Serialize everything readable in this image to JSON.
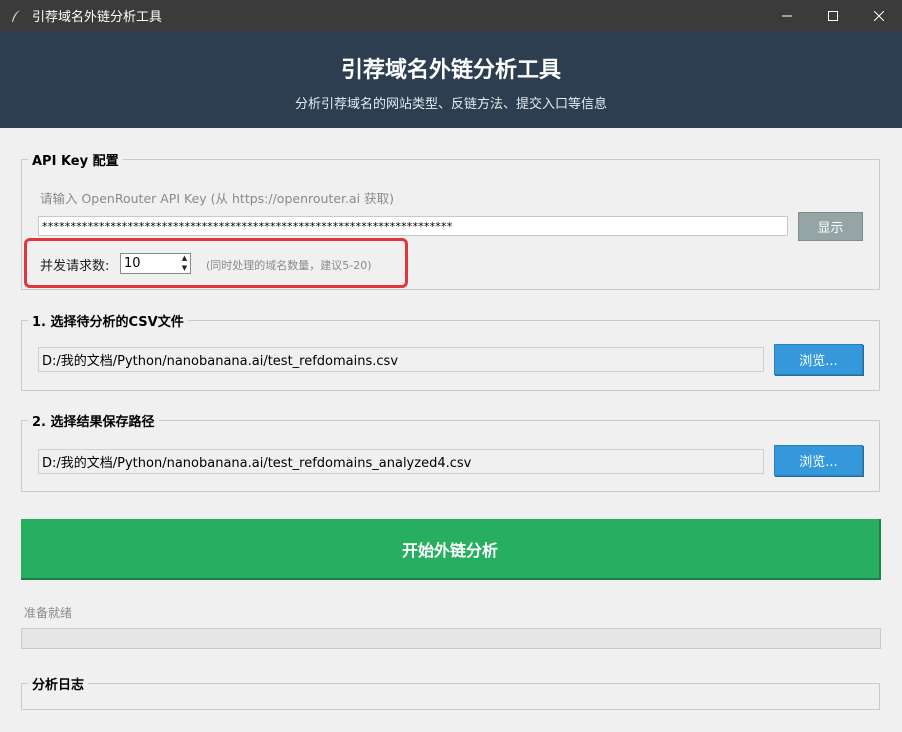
{
  "window": {
    "title": "引荐域名外链分析工具",
    "controls": [
      "minimize",
      "maximize",
      "close"
    ]
  },
  "header": {
    "title": "引荐域名外链分析工具",
    "subtitle": "分析引荐域名的网站类型、反链方法、提交入口等信息"
  },
  "api_section": {
    "legend": "API Key 配置",
    "hint": "请输入 OpenRouter API Key (从 https://openrouter.ai 获取)",
    "key_value": "************************************************************************",
    "show_button": "显示",
    "concurrency_label": "并发请求数:",
    "concurrency_value": "10",
    "concurrency_hint": "(同时处理的域名数量，建议5-20)"
  },
  "input_section": {
    "legend": "1. 选择待分析的CSV文件",
    "path": "D:/我的文档/Python/nanobanana.ai/test_refdomains.csv",
    "browse_button": "浏览..."
  },
  "output_section": {
    "legend": "2. 选择结果保存路径",
    "path": "D:/我的文档/Python/nanobanana.ai/test_refdomains_analyzed4.csv",
    "browse_button": "浏览..."
  },
  "start_button": "开始外链分析",
  "status_text": "准备就绪",
  "progress_value": 0,
  "log_section": {
    "legend": "分析日志"
  },
  "colors": {
    "header_bg": "#2c3e50",
    "start_green": "#27ae60",
    "browse_blue": "#3498db",
    "show_gray": "#95a5a6",
    "highlight_red": "#e0373e"
  }
}
